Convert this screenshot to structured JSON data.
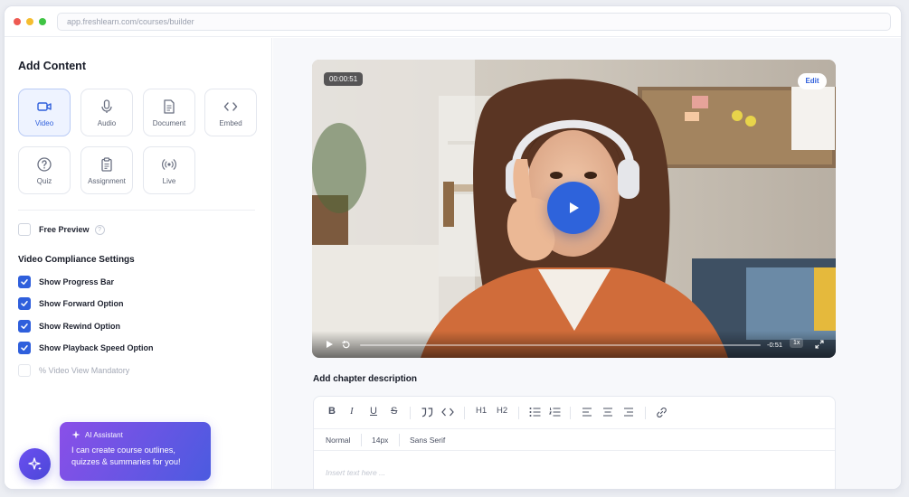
{
  "browser": {
    "url": "app.freshlearn.com/courses/builder"
  },
  "sidebar": {
    "title": "Add Content",
    "content_types": [
      {
        "label": "Video",
        "icon": "video-icon",
        "active": true
      },
      {
        "label": "Audio",
        "icon": "microphone-icon",
        "active": false
      },
      {
        "label": "Document",
        "icon": "document-icon",
        "active": false
      },
      {
        "label": "Embed",
        "icon": "code-icon",
        "active": false
      },
      {
        "label": "Quiz",
        "icon": "question-icon",
        "active": false
      },
      {
        "label": "Assignment",
        "icon": "clipboard-icon",
        "active": false
      },
      {
        "label": "Live",
        "icon": "broadcast-icon",
        "active": false
      }
    ],
    "free_preview": {
      "label": "Free Preview",
      "checked": false
    },
    "compliance": {
      "title": "Video Compliance Settings",
      "options": [
        {
          "label": "Show Progress Bar",
          "checked": true
        },
        {
          "label": "Show Forward Option",
          "checked": true
        },
        {
          "label": "Show Rewind Option",
          "checked": true
        },
        {
          "label": "Show Playback Speed Option",
          "checked": true
        },
        {
          "label": "% Video View Mandatory",
          "checked": false
        }
      ]
    }
  },
  "ai_assistant": {
    "title": "AI Assistant",
    "message": "I can create course outlines, quizzes & summaries for you!"
  },
  "video": {
    "timestamp": "00:00:51",
    "edit_label": "Edit",
    "remaining": "-0:51",
    "speed": "1x",
    "progress": 0.0
  },
  "editor": {
    "chapter_title": "Add chapter description",
    "toolbar": [
      "bold-icon",
      "italic-icon",
      "underline-icon",
      "strikethrough-icon",
      "quote-icon",
      "code-icon",
      "heading1-icon",
      "heading2-icon",
      "bullet-list-icon",
      "numbered-list-icon",
      "align-left-icon",
      "align-center-icon",
      "align-right-icon",
      "link-icon"
    ],
    "heading1": "H1",
    "heading2": "H2",
    "style": "Normal",
    "size": "14px",
    "font": "Sans Serif",
    "placeholder": "Insert text here ..."
  },
  "colors": {
    "accent": "#2f5fdc",
    "ai_gradient_start": "#8a4fe8",
    "ai_gradient_end": "#4b5be0"
  }
}
